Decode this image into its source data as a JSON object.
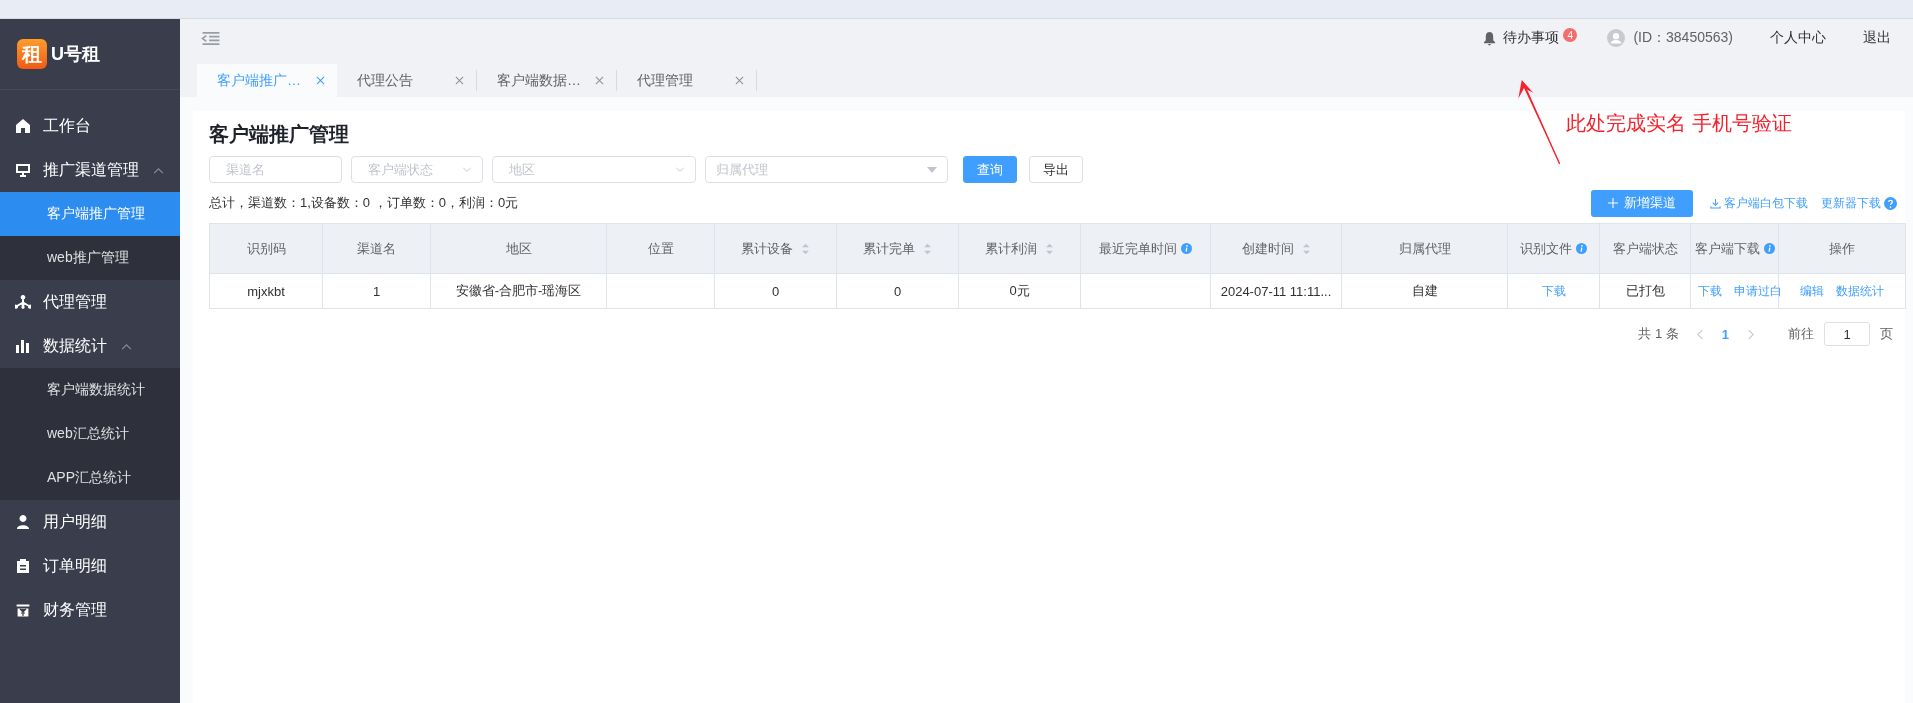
{
  "logo": {
    "glyph": "租",
    "name": "U号租"
  },
  "sidebar": {
    "items": [
      {
        "label": "工作台"
      },
      {
        "label": "推广渠道管理",
        "expanded": true,
        "children": [
          {
            "label": "客户端推广管理",
            "selected": true
          },
          {
            "label": "web推广管理",
            "selected": false
          }
        ]
      },
      {
        "label": "代理管理"
      },
      {
        "label": "数据统计",
        "expanded": true,
        "children": [
          {
            "label": "客户端数据统计",
            "selected": false
          },
          {
            "label": "web汇总统计",
            "selected": false
          },
          {
            "label": "APP汇总统计",
            "selected": false
          }
        ]
      },
      {
        "label": "用户明细"
      },
      {
        "label": "订单明细"
      },
      {
        "label": "财务管理"
      }
    ]
  },
  "header": {
    "todo": "待办事项",
    "todo_count": "4",
    "user_id": "(ID：38450563)",
    "links": [
      "个人中心",
      "退出"
    ]
  },
  "tabs": [
    {
      "label": "客户端推广…",
      "selected": true
    },
    {
      "label": "代理公告",
      "selected": false
    },
    {
      "label": "客户端数据…",
      "selected": false
    },
    {
      "label": "代理管理",
      "selected": false
    }
  ],
  "page_title": "客户端推广管理",
  "filters": [
    {
      "kind": "input",
      "placeholder": "渠道名"
    },
    {
      "kind": "select",
      "placeholder": "客户端状态"
    },
    {
      "kind": "select",
      "placeholder": "地区"
    },
    {
      "kind": "dropdown",
      "placeholder": "归属代理"
    }
  ],
  "buttons": [
    {
      "label": "查询",
      "primary": true
    },
    {
      "label": "导出",
      "primary": false
    }
  ],
  "summary": "总计，渠道数：1,设备数：0 ，订单数：0，利润：0元",
  "add_button": "新增渠道",
  "download_links": [
    {
      "label": "客户端白包下载"
    },
    {
      "label": "更新器下载"
    }
  ],
  "table": {
    "columns": [
      {
        "label": "识别码",
        "sortable": false,
        "info": false
      },
      {
        "label": "渠道名",
        "sortable": false,
        "info": false
      },
      {
        "label": "地区",
        "sortable": false,
        "info": false
      },
      {
        "label": "位置",
        "sortable": false,
        "info": false
      },
      {
        "label": "累计设备",
        "sortable": true,
        "info": false
      },
      {
        "label": "累计完单",
        "sortable": true,
        "info": false
      },
      {
        "label": "累计利润",
        "sortable": true,
        "info": false
      },
      {
        "label": "最近完单时间",
        "sortable": false,
        "info": true
      },
      {
        "label": "创建时间",
        "sortable": true,
        "info": false
      },
      {
        "label": "归属代理",
        "sortable": false,
        "info": false
      },
      {
        "label": "识别文件",
        "sortable": false,
        "info": true
      },
      {
        "label": "客户端状态",
        "sortable": false,
        "info": false
      },
      {
        "label": "客户端下载",
        "sortable": false,
        "info": true
      },
      {
        "label": "操作",
        "sortable": false,
        "info": false
      }
    ],
    "rows": [
      [
        {
          "kind": "text",
          "text": "mjxkbt"
        },
        {
          "kind": "text",
          "text": "1"
        },
        {
          "kind": "text",
          "text": "安徽省-合肥市-瑶海区"
        },
        {
          "kind": "empty"
        },
        {
          "kind": "text",
          "text": "0"
        },
        {
          "kind": "text",
          "text": "0"
        },
        {
          "kind": "text",
          "text": "0元"
        },
        {
          "kind": "empty"
        },
        {
          "kind": "text",
          "text": "2024-07-11 11:11..."
        },
        {
          "kind": "text",
          "text": "自建"
        },
        {
          "kind": "links",
          "links": [
            "下载"
          ]
        },
        {
          "kind": "text",
          "text": "已打包"
        },
        {
          "kind": "links",
          "links": [
            "下载",
            "申请过白"
          ]
        },
        {
          "kind": "links",
          "links": [
            "编辑",
            "数据统计"
          ]
        }
      ]
    ]
  },
  "pagination": {
    "total": "共 1 条",
    "pages": [
      {
        "label": "1",
        "selected": true
      }
    ],
    "goto": "前往",
    "goto_value": "1",
    "unit": "页"
  },
  "annotation": {
    "text": "此处完成实名 手机号验证"
  }
}
